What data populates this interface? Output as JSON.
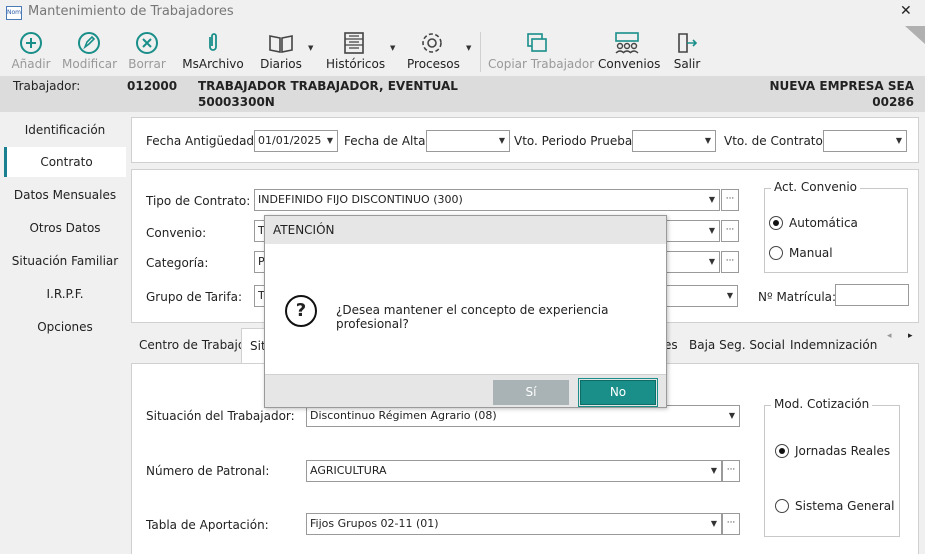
{
  "window": {
    "title": "Mantenimiento de Trabajadores",
    "app_icon_text": "Nom",
    "close_glyph": "✕"
  },
  "toolbar": {
    "items": [
      {
        "label": "Añadir",
        "icon": "plus-circle-icon",
        "enabled": false
      },
      {
        "label": "Modificar",
        "icon": "pencil-circle-icon",
        "enabled": false
      },
      {
        "label": "Borrar",
        "icon": "x-circle-icon",
        "enabled": false
      },
      {
        "label": "MsArchivo",
        "icon": "paperclip-icon",
        "enabled": true
      },
      {
        "label": "Diarios",
        "icon": "book-icon",
        "enabled": true
      },
      {
        "label": "Históricos",
        "icon": "list-icon",
        "enabled": true
      },
      {
        "label": "Procesos",
        "icon": "gear-icon",
        "enabled": true
      },
      {
        "label": "Copiar Trabajador",
        "icon": "copy-icon",
        "enabled": false
      },
      {
        "label": "Convenios",
        "icon": "group-icon",
        "enabled": true
      },
      {
        "label": "Salir",
        "icon": "exit-icon",
        "enabled": true
      }
    ]
  },
  "worker": {
    "label": "Trabajador:",
    "code": "012000",
    "name": "TRABAJADOR TRABAJADOR, EVENTUAL",
    "id": "50003300N",
    "company": "NUEVA EMPRESA SEA",
    "company_code": "00286"
  },
  "nav": {
    "items": [
      "Identificación",
      "Contrato",
      "Datos Mensuales",
      "Otros Datos",
      "Situación Familiar",
      "I.R.P.F.",
      "Opciones"
    ],
    "active": "Contrato"
  },
  "dates": {
    "antiguedad_label": "Fecha Antigüedad:",
    "antiguedad_value": "01/01/2025",
    "alta_label": "Fecha de Alta:",
    "alta_value": "",
    "prueba_label": "Vto. Periodo Prueba:",
    "prueba_value": "",
    "contrato_label": "Vto. de Contrato:",
    "contrato_value": ""
  },
  "contract": {
    "tipo_label": "Tipo de Contrato:",
    "tipo_value": "INDEFINIDO FIJO DISCONTINUO (300)",
    "convenio_label": "Convenio:",
    "convenio_value": "T",
    "categoria_label": "Categoría:",
    "categoria_value": "P",
    "grupo_label": "Grupo de Tarifa:",
    "grupo_value": "T",
    "act_convenio_title": "Act. Convenio",
    "auto_label": "Automática",
    "manual_label": "Manual",
    "act_convenio_selected": "Automática",
    "matricula_label": "Nº Matrícula:",
    "matricula_value": ""
  },
  "tabs": {
    "items": [
      "Centro de Trabajo",
      "Sit",
      "es",
      "Baja Seg. Social",
      "Indemnización"
    ],
    "scroll_left": "◂",
    "scroll_right": "▸"
  },
  "situation": {
    "situacion_label": "Situación del Trabajador:",
    "situacion_value": "Discontinuo Régimen Agrario (08)",
    "patronal_label": "Número de Patronal:",
    "patronal_value": "AGRICULTURA",
    "aportacion_label": "Tabla de Aportación:",
    "aportacion_value": "Fijos Grupos 02-11 (01)",
    "mod_title": "Mod. Cotización",
    "jornadas_label": "Jornadas Reales",
    "general_label": "Sistema General",
    "mod_selected": "Jornadas Reales"
  },
  "dialog": {
    "title": "ATENCIÓN",
    "message": "¿Desea mantener el concepto de experiencia profesional?",
    "icon_glyph": "?",
    "yes_label": "Sí",
    "no_label": "No"
  },
  "colors": {
    "accent": "#1a8f8a",
    "nav_active_border": "#1a7f8e",
    "disabled_button": "#a9b3b6"
  }
}
